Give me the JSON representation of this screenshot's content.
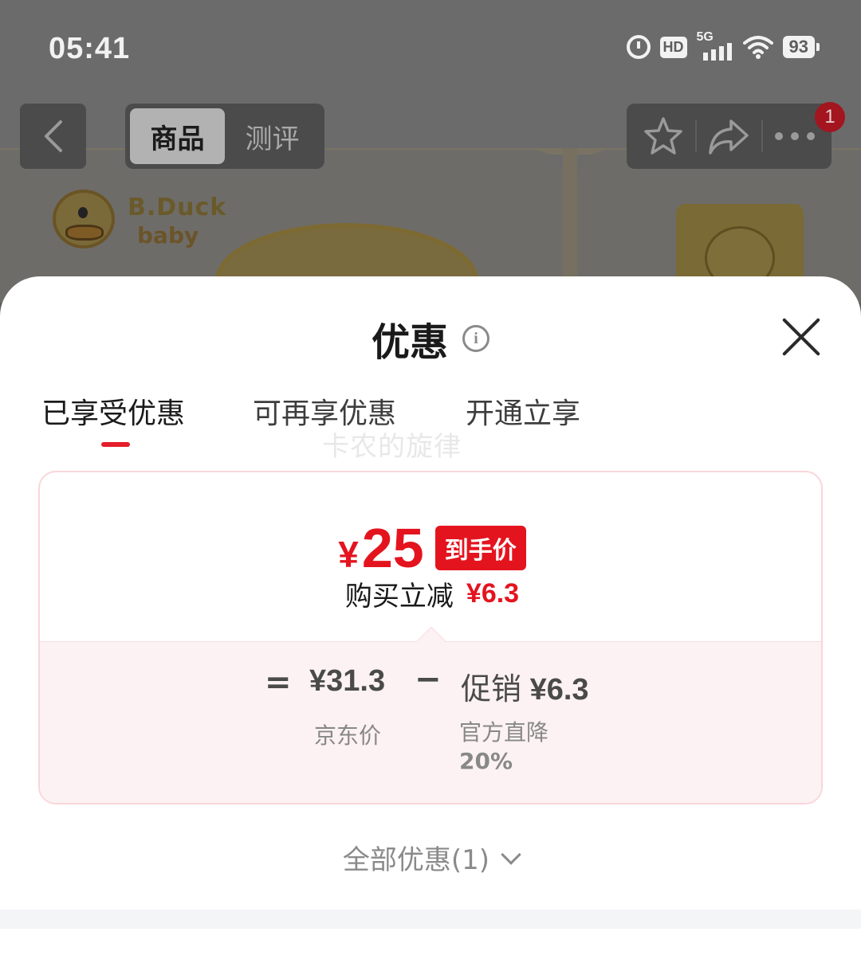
{
  "status_bar": {
    "time": "05:41",
    "hd_label": "HD",
    "network_label": "5G",
    "battery_level": "93",
    "icons": [
      "alarm-icon",
      "hd-icon",
      "signal-5g-icon",
      "wifi-icon",
      "battery-icon"
    ]
  },
  "background": {
    "brand_top": "B.Duck",
    "brand_bottom": "baby"
  },
  "nav": {
    "tabs": [
      {
        "label": "商品",
        "active": true
      },
      {
        "label": "测评",
        "active": false
      }
    ],
    "icons": [
      "back-icon",
      "favorite-star-icon",
      "share-icon",
      "more-icon"
    ],
    "badge_count": "1"
  },
  "sheet": {
    "title": "优惠",
    "info_icon": "i",
    "tabs": [
      {
        "label": "已享受优惠",
        "active": true
      },
      {
        "label": "可再享优惠",
        "active": false
      },
      {
        "label": "开通立享",
        "active": false
      }
    ],
    "watermark": "卡农的旋律",
    "card": {
      "currency": "¥",
      "final_price": "25",
      "final_price_tag": "到手价",
      "saving_label": "购买立减",
      "saving_value": "¥6.3",
      "equals": "=",
      "jd_price": "¥31.3",
      "jd_price_label": "京东价",
      "minus": "−",
      "promo_label": "促销",
      "promo_value": "¥6.3",
      "promo_desc_line1": "官方直降",
      "promo_desc_line2": "20%"
    },
    "all_promos_label": "全部优惠(1)"
  },
  "colors": {
    "accent_red": "#e4141f",
    "overlay_bg": "#5e5e5e",
    "card_border": "#f9d6da",
    "calc_bg": "#fdf2f3"
  }
}
